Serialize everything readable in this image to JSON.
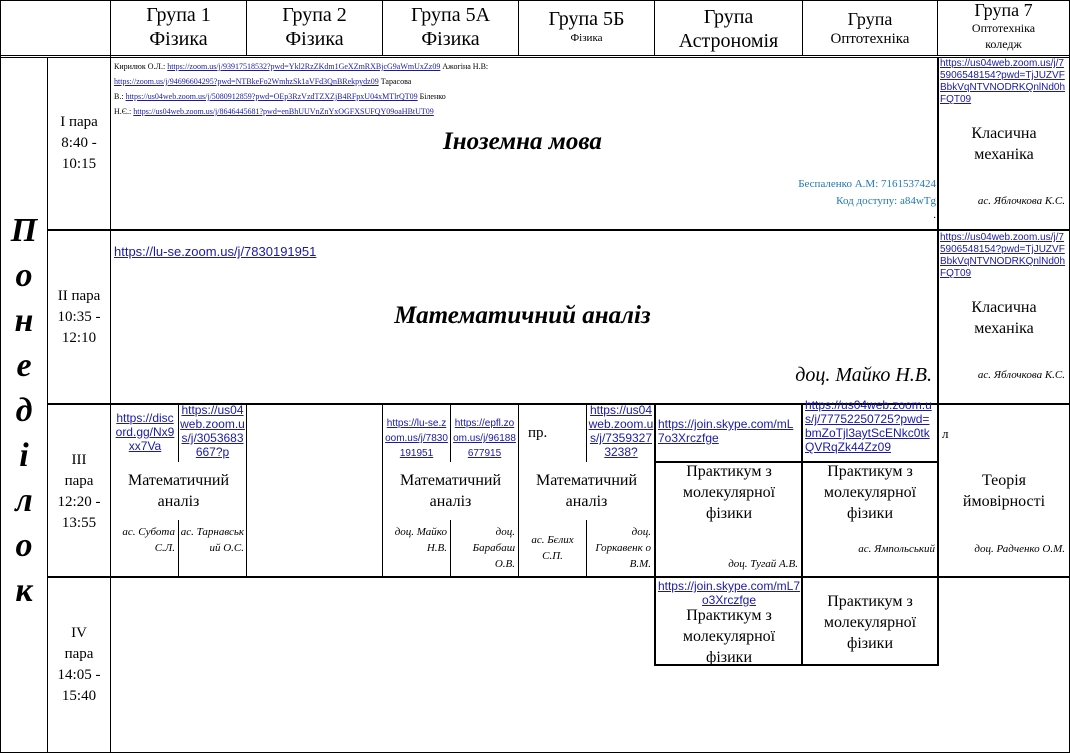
{
  "header": {
    "g1": {
      "name": "Група 1",
      "spec": "Фізика"
    },
    "g2": {
      "name": "Група 2",
      "spec": "Фізика"
    },
    "g5a": {
      "name": "Група 5А",
      "spec": "Фізика"
    },
    "g5b": {
      "name": "Група 5Б",
      "spec": "Фізика"
    },
    "astro": {
      "name": "Група",
      "spec": "Астрономія"
    },
    "opto": {
      "name": "Група",
      "spec": "Оптотехніка"
    },
    "g7": {
      "name": "Група 7",
      "spec": "Оптотехніка",
      "spec2": "коледж"
    }
  },
  "day": [
    "П",
    "о",
    "н",
    "е",
    "д",
    "і",
    "л",
    "о",
    "к"
  ],
  "periods": [
    {
      "label": "I пара",
      "time1": "8:40 -",
      "time2": "10:15"
    },
    {
      "label": "II пара",
      "time1": "10:35 -",
      "time2": "12:10"
    },
    {
      "label": "III",
      "label2": "пара",
      "time1": "12:20 -",
      "time2": "13:55"
    },
    {
      "label": "IV",
      "label2": "пара",
      "time1": "14:05 -",
      "time2": "15:40"
    }
  ],
  "p1": {
    "links_line1_name": "Кирилюк О.Л.:",
    "links_line1_url": "https://zoom.us/j/93917518532?pwd=Ykl2RzZKdm1GeXZmRXBjcG9aWmUxZz09",
    "links_line1_name2": "Ажогіна Н.В:",
    "links_line2_url": "https://zoom.us/j/94696604295?pwd=NTBkeFo2WmhzSk1aVFd3QnBRekpydz09",
    "links_line2_name": "Тарасова",
    "links_line3_prefix": "В.:",
    "links_line3_url": "https://us04web.zoom.us/j/5080912859?pwd=OEp3RzVzdTZXZjB4RFpxU04xMTlrQT09",
    "links_line3_name": "Біленко",
    "links_line4_prefix": "Н.Є.:",
    "links_line4_url": "https://us04web.zoom.us/j/8646445681?pwd=enBhUUVnZnYxOGFXSUFQY09oaHBtUT09",
    "subject": "Іноземна мова",
    "note1": "Беспаленко А.М: 7161537424",
    "note2": "Код доступу: a84wTg",
    "note3": ".",
    "g7_link": "https://us04web.zoom.us/j/75906548154?pwd=TjJUZVFBbkVqNTVNODRKQnlNd0hFQT09",
    "g7_subject1": "Класична",
    "g7_subject2": "механіка",
    "g7_teacher": "ас. Яблочкова К.С."
  },
  "p2": {
    "link": "https://lu-se.zoom.us/j/7830191951",
    "subject": "Математичний аналіз",
    "teacher": "доц. Майко Н.В.",
    "g7_link": "https://us04web.zoom.us/j/75906548154?pwd=TjJUZVFBbkVqNTVNODRKQnlNd0hFQT09",
    "g7_subject1": "Класична",
    "g7_subject2": "механіка",
    "g7_teacher": "ас. Яблочкова К.С."
  },
  "p3": {
    "g1a_link": "https://discord.gg/Nx9xx7Va",
    "g1b_link": "https://us04web.zoom.us/j/3053683667?p",
    "g1_subject1": "Математичний",
    "g1_subject2": "аналіз",
    "g1a_teacher": "ас. Субота С.Л.",
    "g1b_teacher": "ас. Тарнавськ ий О.С.",
    "g5a_a_link": "https://lu-se.zoom.us/j/7830191951",
    "g5a_b_link": "https://epfl.zoom.us/j/96188677915",
    "g5a_subject1": "Математичний",
    "g5a_subject2": "аналіз",
    "g5a_a_teacher": "доц. Майко Н.В.",
    "g5a_b_teacher": "доц. Барабаш О.В.",
    "g5b_pr": "пр.",
    "g5b_link": "https://us04web.zoom.us/j/73593273238?",
    "g5b_subject1": "Математичний",
    "g5b_subject2": "аналіз",
    "g5b_a_teacher": "ас. Бєлих С.П.",
    "g5b_b_teacher": "доц. Горкавенк о В.М.",
    "astro_link": "https://join.skype.com/mL7o3Xrczfge",
    "astro_subject1": "Практикум з",
    "astro_subject2": "молекулярної",
    "astro_subject3": "фізики",
    "astro_teacher": "доц. Тугай А.В.",
    "opto_link": "https://us04web.zoom.us/j/77752250725?pwd=bmZoTjl3aytScENkc0tkQVRqZk44Zz09",
    "opto_subject1": "Практикум з",
    "opto_subject2": "молекулярної",
    "opto_subject3": "фізики",
    "opto_teacher": "ас. Ямпольський",
    "g7_mark": "л",
    "g7_subject1": "Теорія",
    "g7_subject2": "ймовірності",
    "g7_teacher": "доц. Радченко О.М."
  },
  "p4": {
    "astro_link": "https://join.skype.com/mL7o3Xrczfge",
    "astro_subject1": "Практикум з",
    "astro_subject2": "молекулярної",
    "astro_subject3": "фізики",
    "opto_subject1": "Практикум з",
    "opto_subject2": "молекулярної",
    "opto_subject3": "фізики"
  }
}
